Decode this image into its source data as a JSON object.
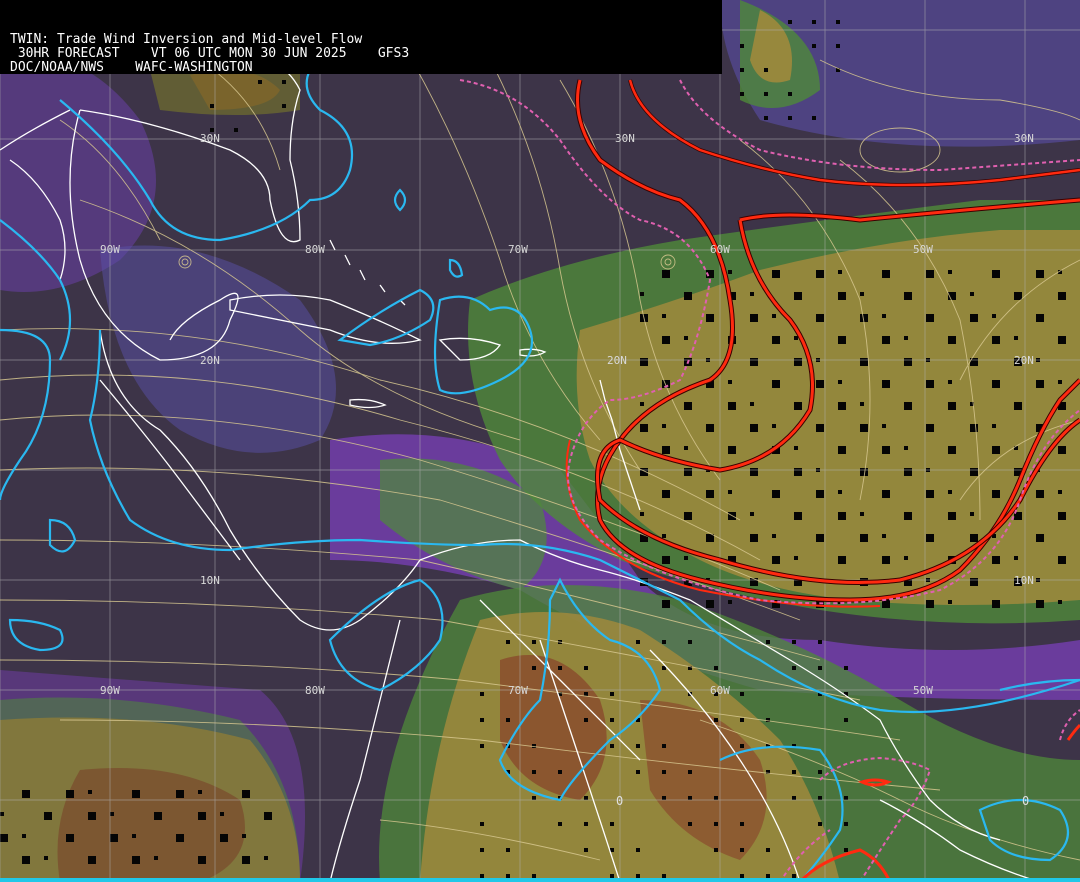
{
  "header": {
    "line1": "TWIN: Trade Wind Inversion and Mid-level Flow",
    "line2": " 30HR FORECAST    VT 06 UTC MON 30 JUN 2025    GFS3",
    "line3": "DOC/NOAA/NWS    WAFC-WASHINGTON"
  },
  "grid_labels": {
    "lat_30n_a": "30N",
    "lat_30n_b": "30N",
    "lat_30n_c": "30N",
    "lat_20n_a": "20N",
    "lat_20n_b": "20N",
    "lat_20n_c": "20N",
    "lat_10n_a": "10N",
    "lat_10n_b": "10N",
    "lon_90w_a": "90W",
    "lon_80w_a": "80W",
    "lon_70w_a": "70W",
    "lon_60w_a": "60W",
    "lon_50w_a": "50W",
    "lon_90w_b": "90W",
    "lon_80w_b": "80W",
    "lon_70w_b": "70W",
    "lon_60w_b": "60W",
    "lon_50w_b": "50W",
    "eq_60w": "0",
    "eq_40w": "0"
  },
  "colors": {
    "background": "#3d3448",
    "purple": "#7a3fb8",
    "blue_violet": "#5a4fa8",
    "green": "#4f8a3a",
    "olive": "#7a7a2a",
    "tan": "#a08a3c",
    "brown": "#8a4a2c",
    "streamline": "#d8c890",
    "coast": "#ffffff",
    "cyan_contour": "#2ab8f0",
    "red_contour": "#ff2a10",
    "magenta_dash": "#e060b0",
    "grid": "#b0b0b0",
    "bottom_bar": "#20c8e8"
  }
}
